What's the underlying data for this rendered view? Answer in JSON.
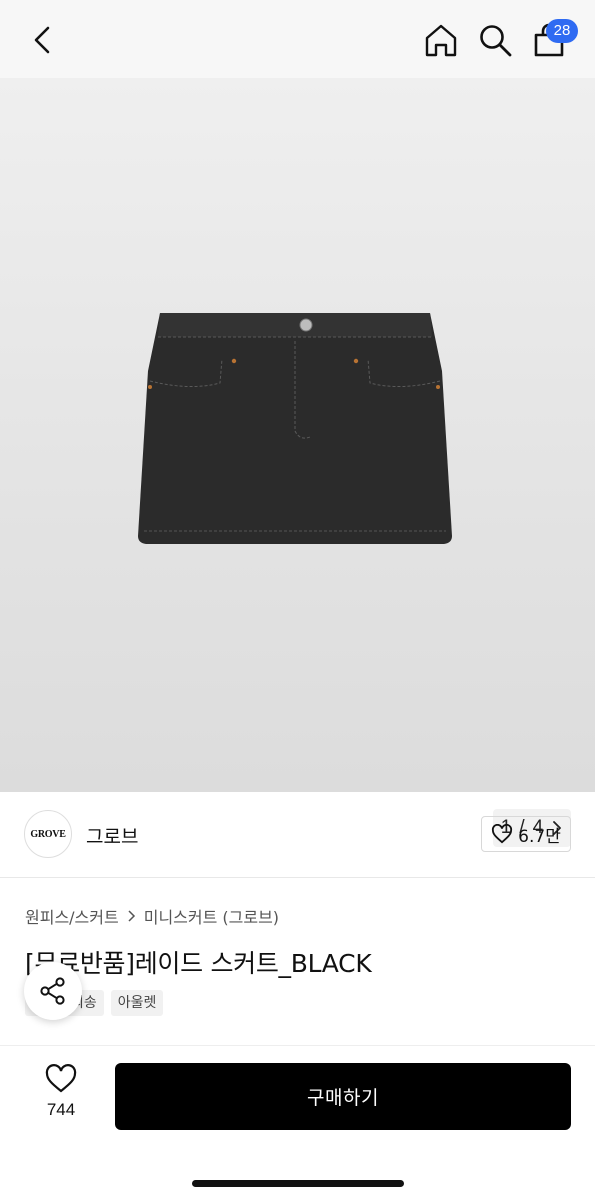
{
  "header": {
    "cart_count": "28",
    "icons": [
      "chevron-left-icon",
      "home-icon",
      "search-icon",
      "shopping-bag-icon"
    ]
  },
  "gallery": {
    "pager_current": "1",
    "pager_sep": "/",
    "pager_total": "4",
    "background": "#e8e8e8"
  },
  "brand": {
    "logo_text": "GROVE",
    "name": "그로브",
    "like_count": "6.7만"
  },
  "breadcrumb": {
    "category": "원피스/스커트",
    "subcategory": "미니스커트 (그로브)"
  },
  "product": {
    "title": "[무료반품]레이드 스커트_BLACK",
    "tags": [
      "회송",
      "아울렛"
    ]
  },
  "bottom": {
    "wish_count": "744",
    "buy_label": "구매하기"
  },
  "colors": {
    "accent": "#2f6bf2",
    "buy_button": "#000000"
  }
}
